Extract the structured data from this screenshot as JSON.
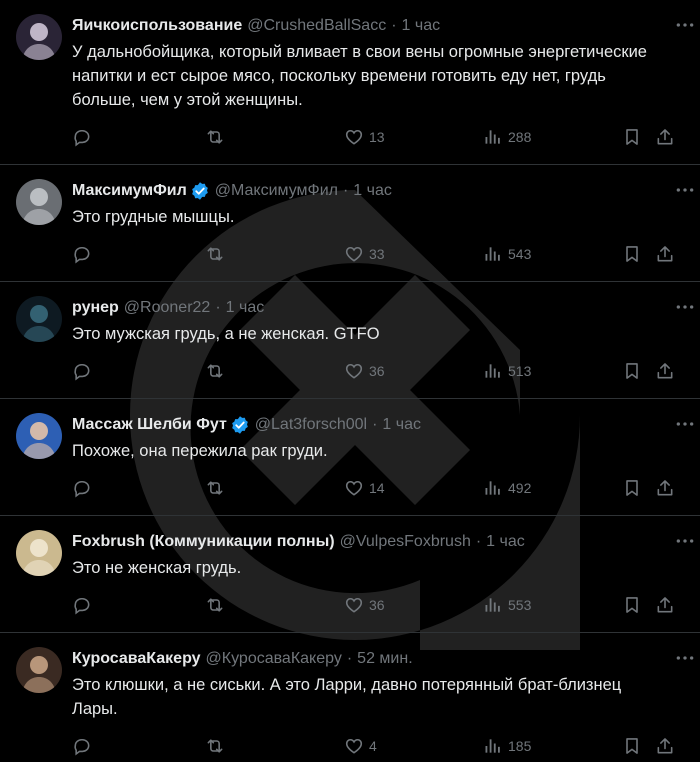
{
  "tweets": [
    {
      "name": "Яичкоиспользование",
      "handle": "@CrushedBallSacc",
      "time": "1 час",
      "verified": false,
      "text": "У дальнобойщика, который вливает в свои вены огромные энергетические напитки и ест сырое мясо, поскольку времени готовить еду нет, грудь больше, чем у этой женщины.",
      "likes": "13",
      "views": "288",
      "avatar_colors": [
        "#2a2436",
        "#d9cfe0"
      ]
    },
    {
      "name": "МаксимумФил",
      "handle": "@МаксимумФил",
      "time": "1 час",
      "verified": true,
      "text": "Это грудные мышцы.",
      "likes": "33",
      "views": "543",
      "avatar_colors": [
        "#6a6e73",
        "#c8ccd0"
      ]
    },
    {
      "name": "рунер",
      "handle": "@Rooner22",
      "time": "1 час",
      "verified": false,
      "text": "Это мужская грудь, а не женская. GTFO",
      "likes": "36",
      "views": "513",
      "avatar_colors": [
        "#0e1a22",
        "#3a6e80"
      ]
    },
    {
      "name": "Массаж Шелби Фут",
      "handle": "@Lat3forsch00l",
      "time": "1 час",
      "verified": true,
      "text": "Похоже, она пережила рак груди.",
      "likes": "14",
      "views": "492",
      "avatar_colors": [
        "#2d5fb4",
        "#f1c9a8"
      ]
    },
    {
      "name": "Foxbrush (Коммуникации полны)",
      "handle": "@VulpesFoxbrush",
      "time": "1 час",
      "verified": false,
      "text": "Это не женская грудь.",
      "likes": "36",
      "views": "553",
      "avatar_colors": [
        "#cbb98f",
        "#f3ead6"
      ]
    },
    {
      "name": "КуросаваКакеру",
      "handle": "@КуросаваКакеру",
      "time": "52 мин.",
      "verified": false,
      "text": "Это клюшки, а не сиськи. А это Ларри, давно потерянный брат-близнец Лары.",
      "likes": "4",
      "views": "185",
      "avatar_colors": [
        "#3a2a22",
        "#cfa98a"
      ]
    }
  ],
  "colors": {
    "background": "#000000",
    "text": "#e7e9ea",
    "muted": "#71767b",
    "divider": "#2f3336",
    "verified": "#1d9bf0"
  },
  "icons": [
    "reply-icon",
    "retweet-icon",
    "like-icon",
    "views-icon",
    "bookmark-icon",
    "share-icon",
    "more-icon",
    "verified-icon"
  ]
}
